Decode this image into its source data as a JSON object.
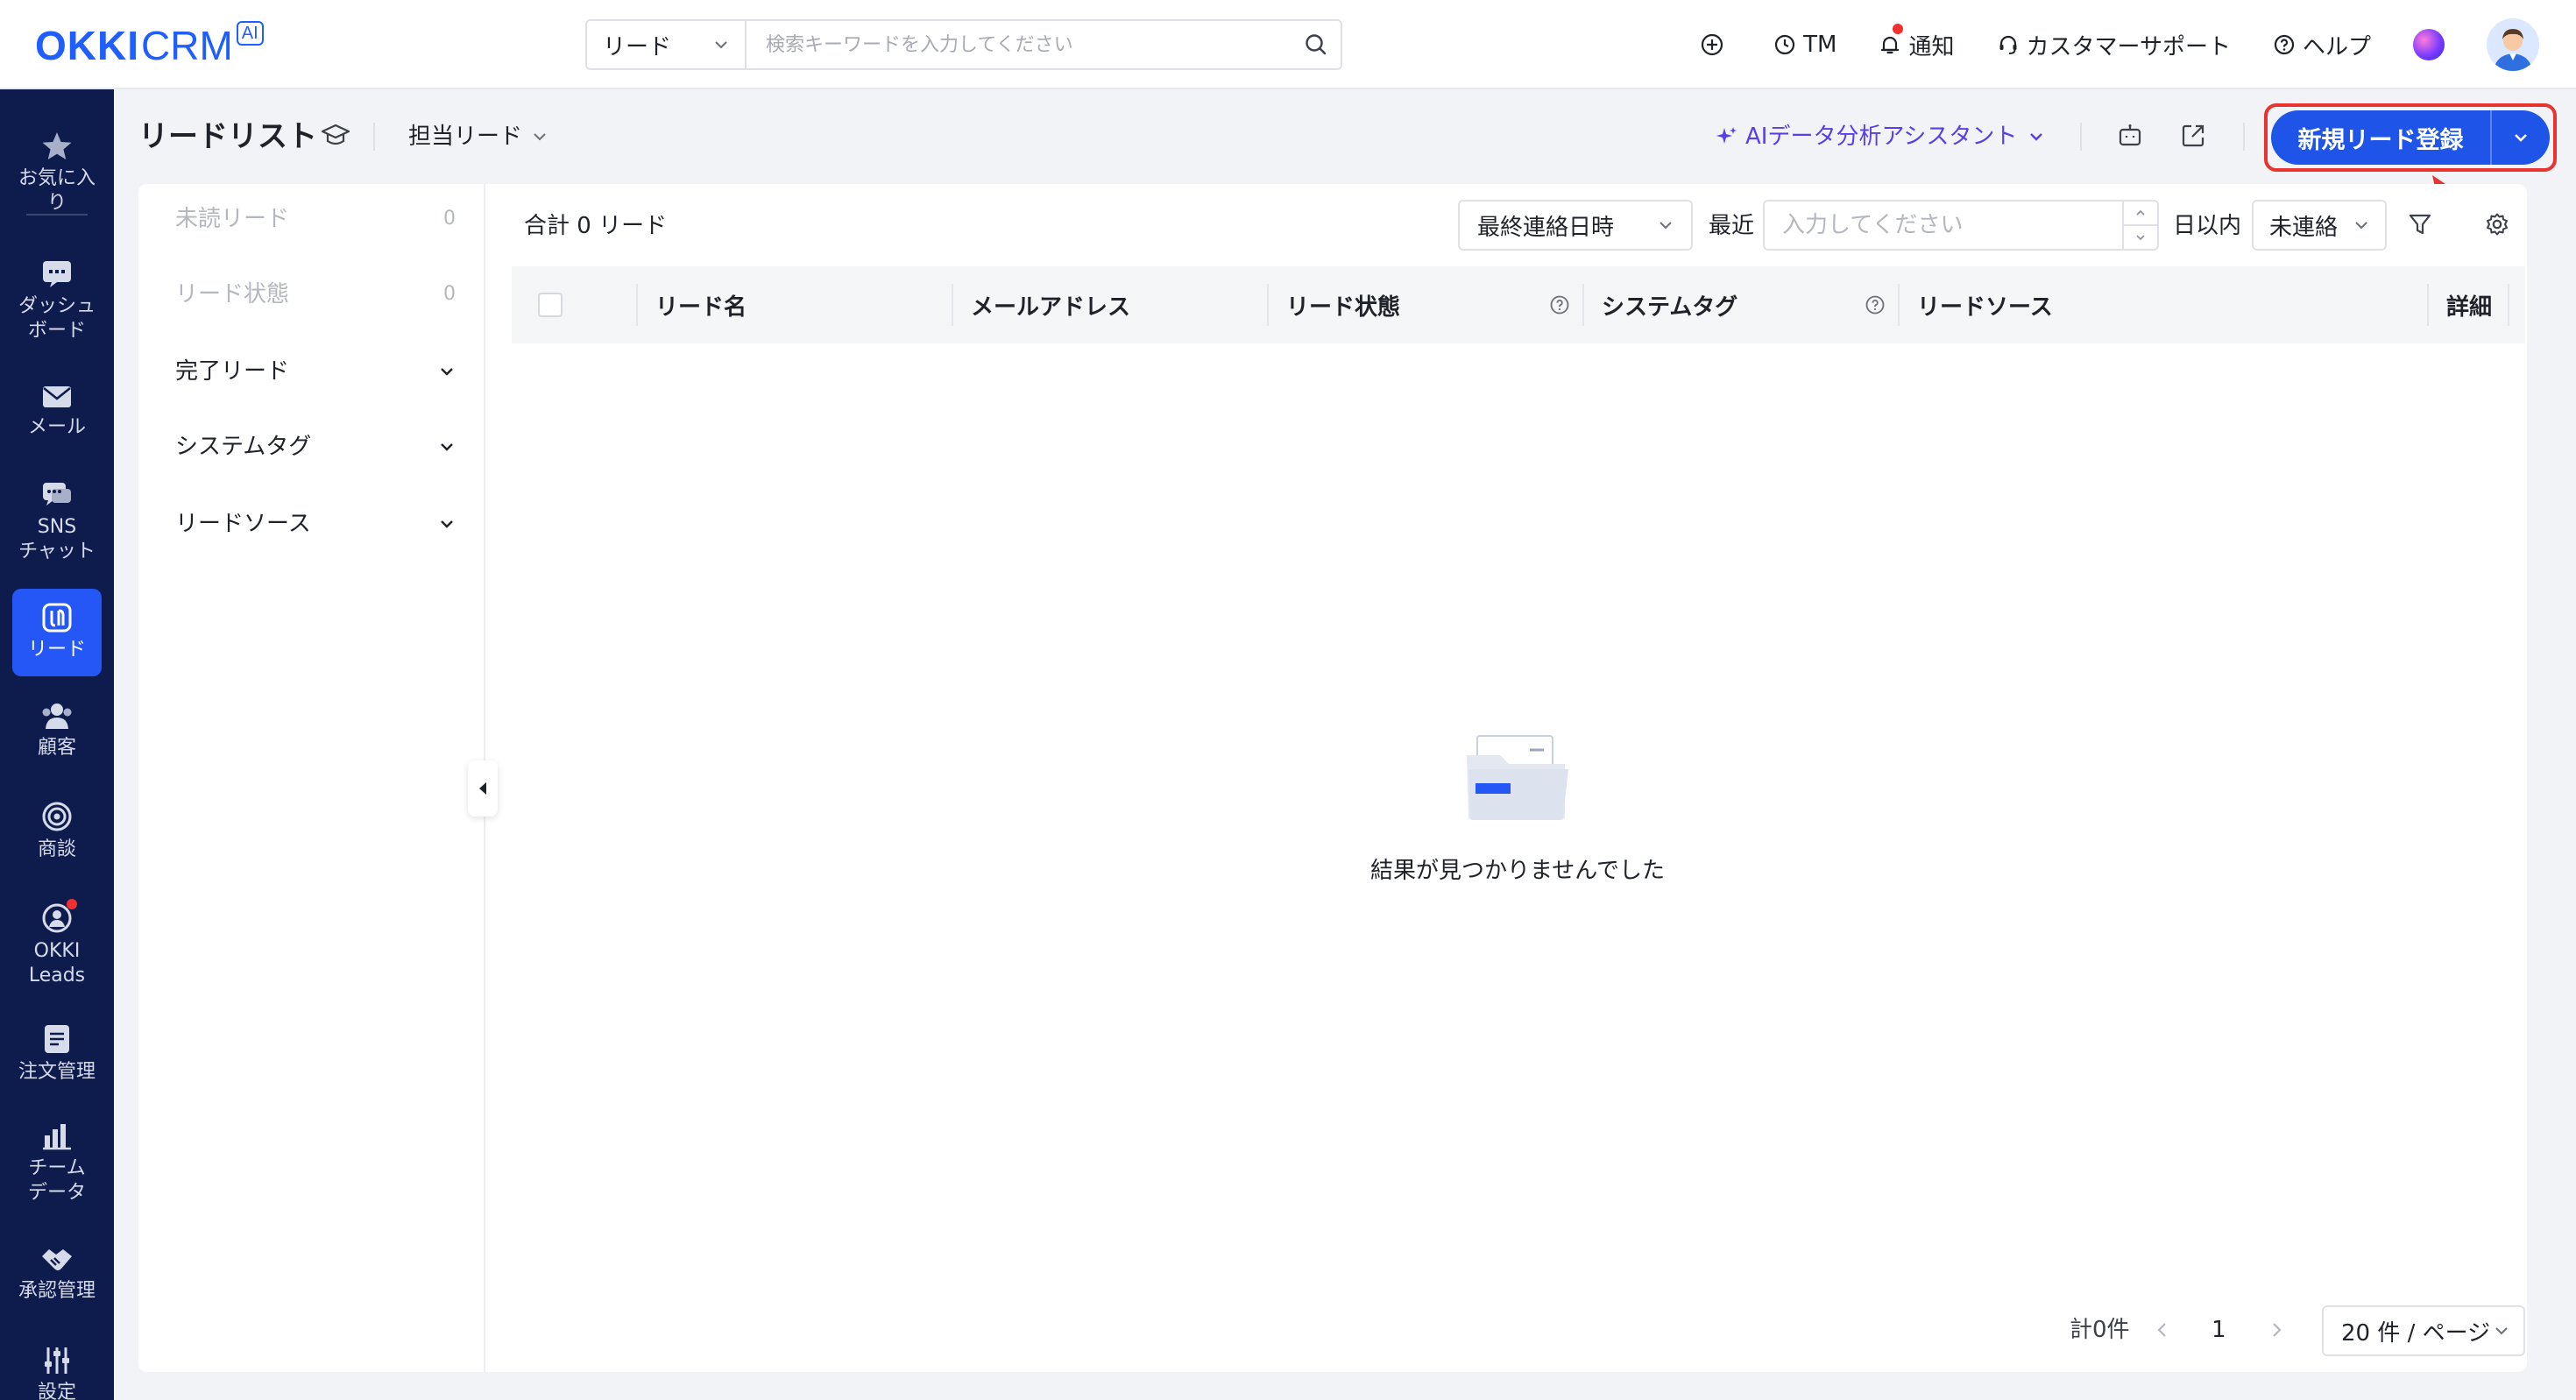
{
  "logo": {
    "brand": "OKKI",
    "product": "CRM",
    "badge": "AI"
  },
  "search": {
    "type_selected": "リード",
    "placeholder": "検索キーワードを入力してください"
  },
  "topbar": {
    "tm_label": "TM",
    "notification_label": "通知",
    "support_label": "カスタマーサポート",
    "help_label": "ヘルプ"
  },
  "leftnav": {
    "items": [
      {
        "label": "お気に入り",
        "icon": "star-icon"
      },
      {
        "label": "ダッシュボード",
        "icon": "dashboard-icon"
      },
      {
        "label": "メール",
        "icon": "mail-icon"
      },
      {
        "label": "SNSチャット",
        "icon": "chat-icon"
      },
      {
        "label": "リード",
        "icon": "lead-icon",
        "active": true
      },
      {
        "label": "顧客",
        "icon": "customers-icon"
      },
      {
        "label": "商談",
        "icon": "target-icon"
      },
      {
        "label": "OKKI Leads",
        "icon": "okki-leads-icon",
        "has_dot": true
      },
      {
        "label": "注文管理",
        "icon": "order-icon"
      },
      {
        "label": "チームデータ",
        "icon": "bar-chart-icon"
      },
      {
        "label": "承認管理",
        "icon": "handshake-icon"
      },
      {
        "label": "設定",
        "icon": "settings-sliders-icon"
      }
    ],
    "labels": {
      "favorites_1": "お気に入",
      "favorites_2": "り",
      "dashboard_1": "ダッシュ",
      "dashboard_2": "ボード",
      "mail": "メール",
      "sns_1": "SNS",
      "sns_2": "チャット",
      "lead": "リード",
      "customers": "顧客",
      "deals": "商談",
      "okki_1": "OKKI",
      "okki_2": "Leads",
      "orders": "注文管理",
      "team_1": "チーム",
      "team_2": "データ",
      "approval": "承認管理",
      "settings": "設定"
    }
  },
  "header": {
    "title": "リードリスト",
    "owner_filter": "担当リード",
    "ai_assistant": "AIデータ分析アシスタント",
    "new_lead_button": "新規リード登録"
  },
  "filters": {
    "unread": {
      "label": "未読リード",
      "count": "0"
    },
    "status": {
      "label": "リード状態",
      "count": "0"
    },
    "completed": {
      "label": "完了リード"
    },
    "system_tag": {
      "label": "システムタグ"
    },
    "source": {
      "label": "リードソース"
    }
  },
  "toolbar": {
    "total_label": "合計 0 リード",
    "sort_field": "最終連絡日時",
    "recent_label": "最近",
    "days_placeholder": "入力してください",
    "within_days_label": "日以内",
    "contact_status": "未連絡"
  },
  "table": {
    "columns": [
      "リード名",
      "メールアドレス",
      "リード状態",
      "システムタグ",
      "リードソース",
      "詳細"
    ],
    "rows": []
  },
  "empty_state": {
    "message": "結果が見つかりませんでした"
  },
  "pagination": {
    "total_label": "計0件",
    "current_page": "1",
    "page_size": "20 件 / ページ"
  },
  "colors": {
    "brand": "#1f5eff",
    "sidebar_bg": "#0e1b4d",
    "active_nav": "#2457f5",
    "primary_button": "#1e54e8",
    "ai_accent": "#5b3de8",
    "highlight_red": "#e8332e"
  }
}
